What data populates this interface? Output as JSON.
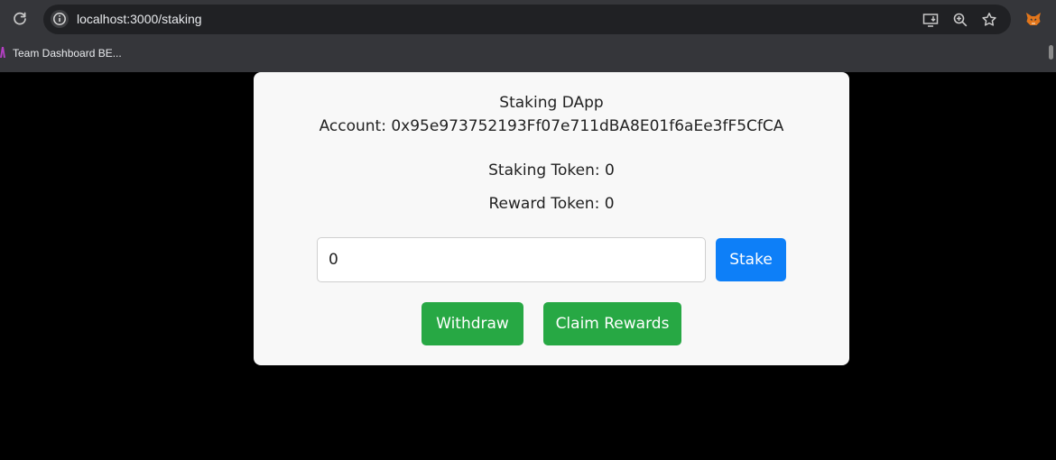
{
  "browser": {
    "url": "localhost:3000/staking",
    "bookmark": "Team Dashboard BE..."
  },
  "app": {
    "title": "Staking DApp",
    "account": "Account: 0x95e973752193Ff07e711dBA8E01f6aEe3fF5CfCA",
    "staking_token": "Staking Token: 0",
    "reward_token": "Reward Token: 0",
    "amount_value": "0",
    "buttons": {
      "stake": "Stake",
      "withdraw": "Withdraw",
      "claim_rewards": "Claim Rewards"
    }
  },
  "colors": {
    "stake": "#0d7ff8",
    "green": "#27a844"
  },
  "icons": {
    "reload": "reload-icon",
    "site_info": "info-icon",
    "install": "install-app-icon",
    "zoom": "zoom-icon",
    "bookmark": "star-icon",
    "extension": "metamask-fox-icon"
  }
}
